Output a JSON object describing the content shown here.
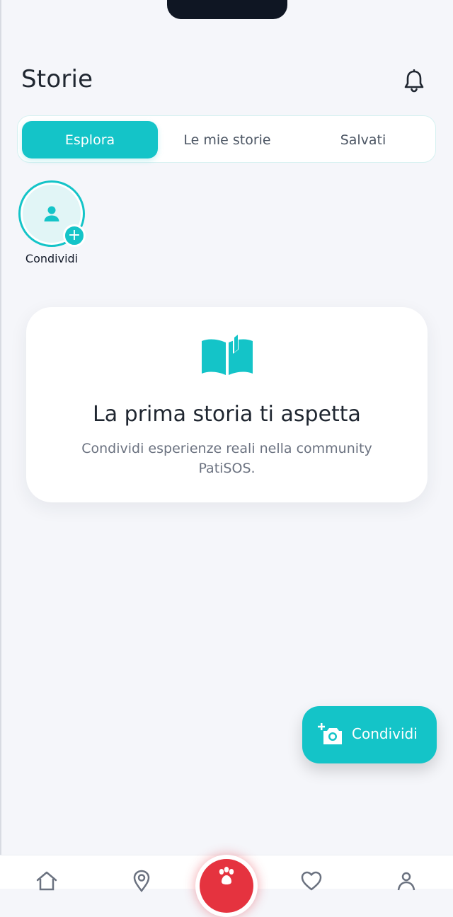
{
  "header": {
    "title": "Storie"
  },
  "tabs": [
    {
      "label": "Esplora",
      "active": true
    },
    {
      "label": "Le mie storie",
      "active": false
    },
    {
      "label": "Salvati",
      "active": false
    }
  ],
  "story_add": {
    "label": "Condividi"
  },
  "empty_state": {
    "title": "La prima storia ti aspetta",
    "description": "Condividi esperienze reali nella community PatiSOS."
  },
  "fab": {
    "label": "Condividi"
  },
  "colors": {
    "accent": "#14c4c8",
    "sos": "#e5333f",
    "background": "#f5f6fa"
  },
  "icons": {
    "header": "bell-icon",
    "story": "person-icon",
    "empty": "open-book-icon",
    "fab": "add-camera-icon",
    "nav": [
      "home-icon",
      "map-pin-icon",
      "paw-icon",
      "heart-icon",
      "profile-icon"
    ]
  }
}
